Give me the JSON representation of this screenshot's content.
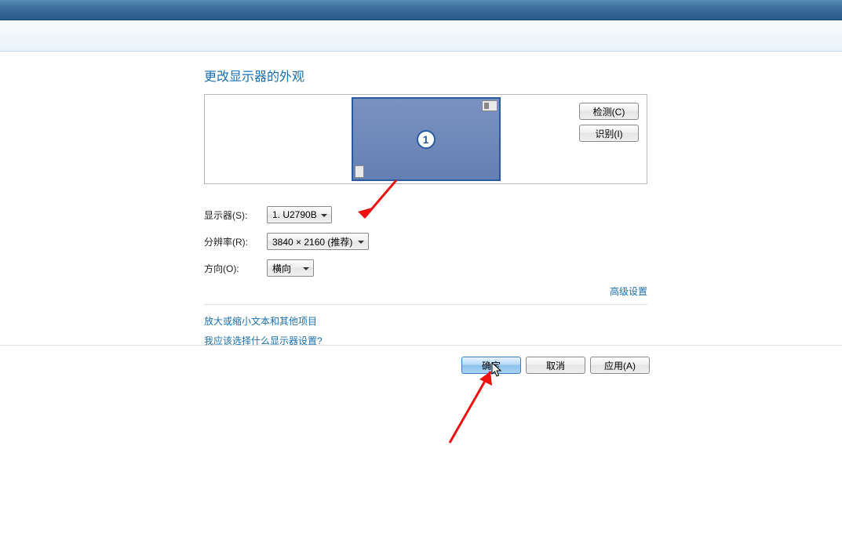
{
  "title": "更改显示器的外观",
  "preview": {
    "monitor_number": "1",
    "detect_label": "检测(C)",
    "identify_label": "识别(I)"
  },
  "rows": {
    "display": {
      "label": "显示器(S):",
      "value": "1. U2790B"
    },
    "resolution": {
      "label": "分辨率(R):",
      "value": "3840 × 2160 (推荐)"
    },
    "orientation": {
      "label": "方向(O):",
      "value": "横向"
    }
  },
  "advanced_link": "高级设置",
  "links": {
    "scale": "放大或缩小文本和其他项目",
    "help": "我应该选择什么显示器设置?"
  },
  "buttons": {
    "ok": "确定",
    "cancel": "取消",
    "apply": "应用(A)"
  }
}
